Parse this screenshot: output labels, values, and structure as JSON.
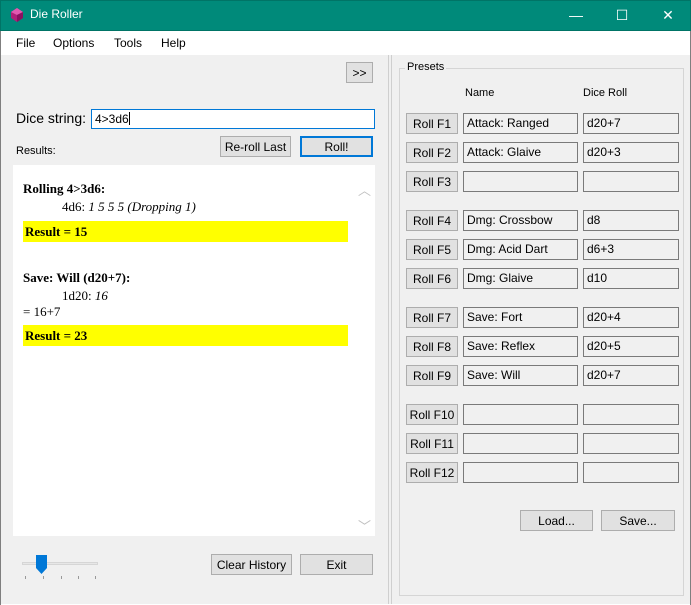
{
  "window": {
    "title": "Die Roller",
    "minimize": "—",
    "maximize": "☐",
    "close": "✕"
  },
  "menu": [
    "File",
    "Options",
    "Tools",
    "Help"
  ],
  "left": {
    "expand_label": ">>",
    "dice_label": "Dice string:",
    "dice_value": "4>3d6",
    "results_label": "Results:",
    "reroll_label": "Re-roll Last",
    "roll_label": "Roll!",
    "clear_label": "Clear History",
    "exit_label": "Exit",
    "slider_level": 0.25
  },
  "results": [
    {
      "heading": "Rolling 4>3d6:",
      "dice": "4d6:",
      "rolls": "1 5 5 5 (Dropping 1)",
      "sum": "",
      "result": "Result = 15"
    },
    {
      "heading": "Save: Will (d20+7):",
      "dice": "1d20:",
      "rolls": "16",
      "sum": "= 16+7",
      "result": "Result = 23"
    }
  ],
  "presets": {
    "title": "Presets",
    "col_name": "Name",
    "col_roll": "Dice Roll",
    "rows": [
      {
        "button": "Roll F1",
        "name": "Attack: Ranged",
        "roll": "d20+7"
      },
      {
        "button": "Roll F2",
        "name": "Attack: Glaive",
        "roll": "d20+3"
      },
      {
        "button": "Roll F3",
        "name": "",
        "roll": ""
      },
      {
        "button": "Roll F4",
        "name": "Dmg: Crossbow",
        "roll": "d8"
      },
      {
        "button": "Roll F5",
        "name": "Dmg: Acid Dart",
        "roll": "d6+3"
      },
      {
        "button": "Roll F6",
        "name": "Dmg: Glaive",
        "roll": "d10"
      },
      {
        "button": "Roll F7",
        "name": "Save: Fort",
        "roll": "d20+4"
      },
      {
        "button": "Roll F8",
        "name": "Save: Reflex",
        "roll": "d20+5"
      },
      {
        "button": "Roll F9",
        "name": "Save: Will",
        "roll": "d20+7"
      },
      {
        "button": "Roll F10",
        "name": "",
        "roll": ""
      },
      {
        "button": "Roll F11",
        "name": "",
        "roll": ""
      },
      {
        "button": "Roll F12",
        "name": "",
        "roll": ""
      }
    ],
    "load_label": "Load...",
    "save_label": "Save..."
  },
  "colors": {
    "titlebar": "#008a7a",
    "result_highlight": "#ffff00",
    "default_button_border": "#0078d7",
    "icon_die": "#b0207a"
  }
}
